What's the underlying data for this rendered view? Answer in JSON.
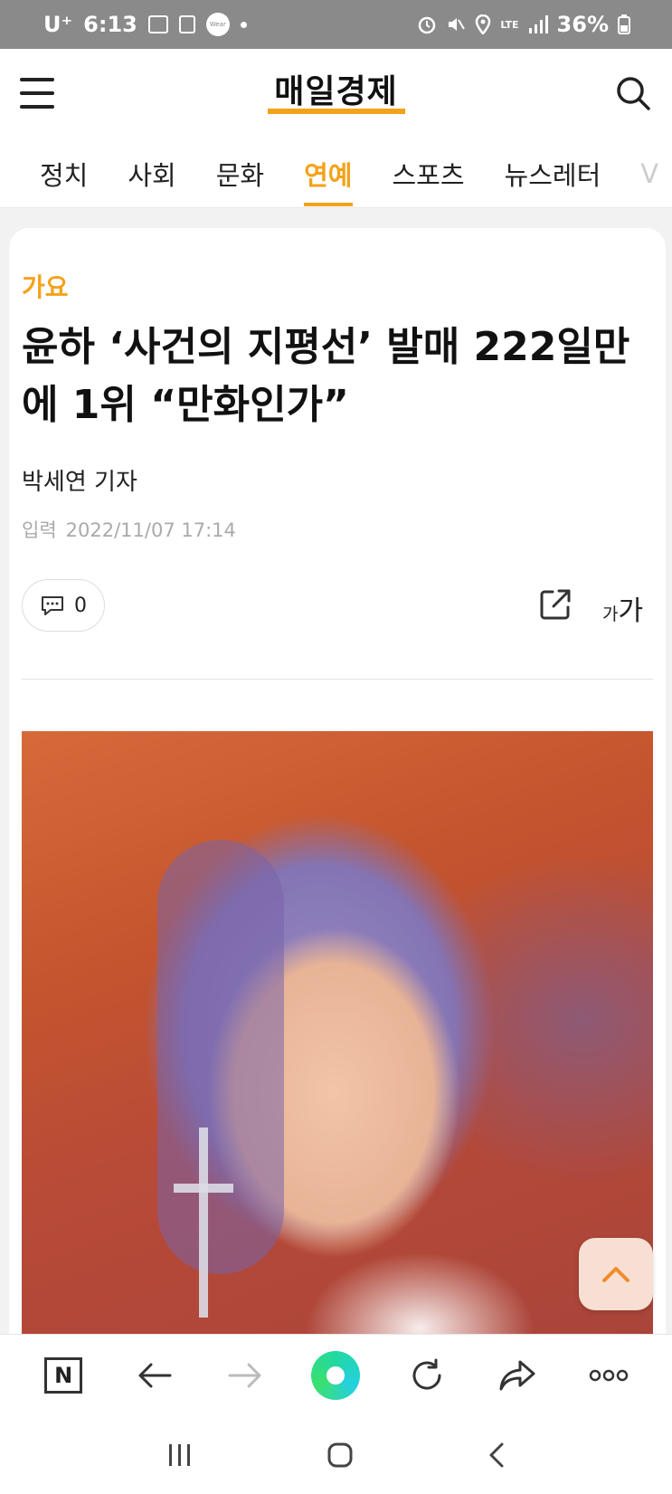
{
  "status_bar": {
    "carrier": "U⁺",
    "time": "6:13",
    "wear_label": "Wear",
    "battery": "36%",
    "network": "LTE"
  },
  "header": {
    "logo": "매일경제",
    "brand_color": "#f4a21a"
  },
  "tabs": [
    {
      "label": "정치",
      "active": false
    },
    {
      "label": "사회",
      "active": false
    },
    {
      "label": "문화",
      "active": false
    },
    {
      "label": "연예",
      "active": true
    },
    {
      "label": "스포츠",
      "active": false
    },
    {
      "label": "뉴스레터",
      "active": false
    },
    {
      "label": "V",
      "active": false
    }
  ],
  "article": {
    "category": "가요",
    "headline": "윤하 ‘사건의 지평선’ 발매 222일만에 1위 “만화인가”",
    "author": "박세연 기자",
    "date_label": "입력",
    "date": "2022/11/07 17:14",
    "comment_count": "0",
    "font_size_small": "가",
    "font_size_large": "가"
  },
  "icons": {
    "menu": "menu-icon",
    "search": "search-icon",
    "comment": "comment-icon",
    "share": "share-icon",
    "scroll_top": "chevron-up-icon",
    "home": "naver-home-icon",
    "back": "arrow-left-icon",
    "forward": "arrow-right-icon",
    "green_dot": "naver-green-dot-icon",
    "reload": "reload-icon",
    "share_tb": "share-arrow-icon",
    "more": "more-icon"
  },
  "toolbar": {
    "home_letter": "N"
  }
}
